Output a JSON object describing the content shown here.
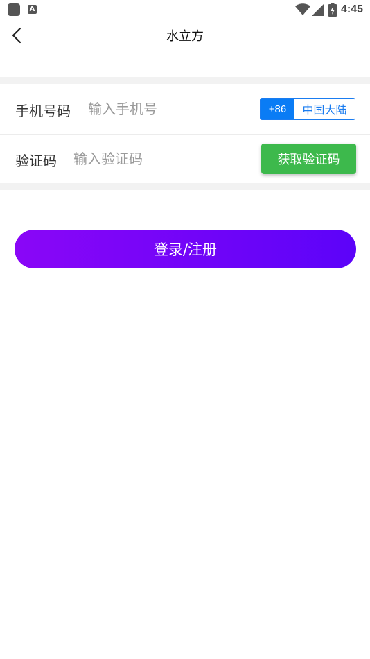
{
  "status_bar": {
    "app_icon": "a-icon",
    "app_icon_letter": "A",
    "time": "4:45"
  },
  "header": {
    "title": "水立方",
    "back_icon": "chevron-left-icon"
  },
  "phone_row": {
    "label": "手机号码",
    "placeholder": "输入手机号",
    "value": "",
    "country_code": "+86",
    "country_name": "中国大陆"
  },
  "code_row": {
    "label": "验证码",
    "placeholder": "输入验证码",
    "value": "",
    "get_code_label": "获取验证码"
  },
  "login": {
    "label": "登录/注册"
  },
  "colors": {
    "accent_blue": "#0a7cf5",
    "button_green": "#3db94c",
    "gradient_start": "#8a06f7",
    "gradient_end": "#5c03f9"
  }
}
